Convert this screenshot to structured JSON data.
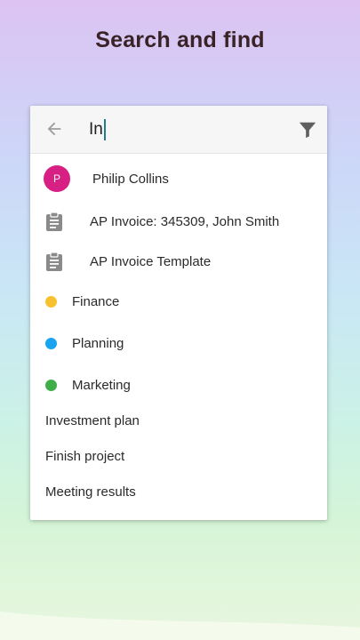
{
  "headline": "Search and find",
  "search": {
    "query": "In",
    "back_icon": "arrow-left-icon",
    "filter_icon": "filter-funnel-icon"
  },
  "colors": {
    "avatar": "#d81f84",
    "finance": "#f7c12f",
    "planning": "#1aa3ef",
    "marketing": "#3fae49"
  },
  "results": {
    "contact": {
      "initial": "P",
      "name": "Philip Collins"
    },
    "doc1": {
      "icon": "clipboard-icon",
      "title": "AP Invoice: 345309, John Smith"
    },
    "doc2": {
      "icon": "clipboard-icon",
      "title": "AP Invoice Template"
    },
    "tag1": "Finance",
    "tag2": "Planning",
    "tag3": "Marketing",
    "text1": "Investment plan",
    "text2": "Finish project",
    "text3": "Meeting results"
  }
}
